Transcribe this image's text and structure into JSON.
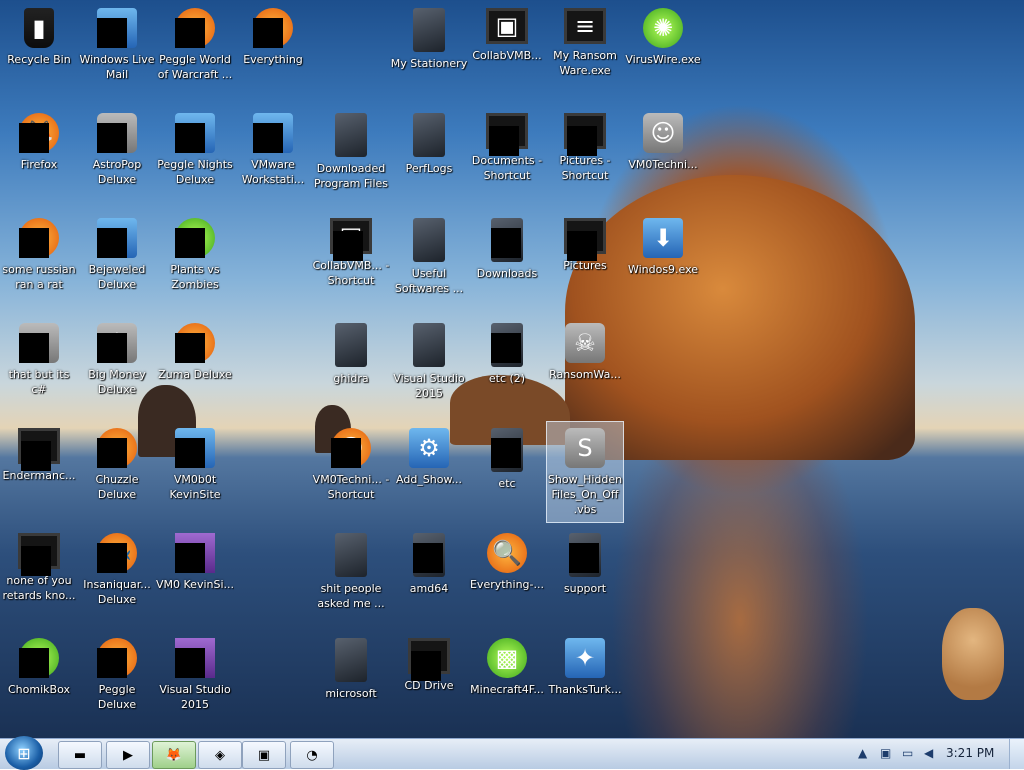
{
  "desktop": {
    "icons": [
      {
        "label": "Recycle Bin",
        "glyph": "▮"
      },
      {
        "label": "Windows Live Mail",
        "glyph": "✉"
      },
      {
        "label": "Peggle World of Warcraft ...",
        "glyph": "●"
      },
      {
        "label": "Everything",
        "glyph": "○"
      },
      {
        "label": "My Stationery",
        "glyph": ""
      },
      {
        "label": "CollabVMB...",
        "glyph": "▣"
      },
      {
        "label": "My Ransom Ware.exe",
        "glyph": "≡"
      },
      {
        "label": "VirusWire.exe",
        "glyph": "✺"
      },
      {
        "label": "Firefox",
        "glyph": "🦊"
      },
      {
        "label": "AstroPop Deluxe",
        "glyph": "★"
      },
      {
        "label": "Peggle Nights Deluxe",
        "glyph": "☾"
      },
      {
        "label": "VMware Workstati...",
        "glyph": "▤"
      },
      {
        "label": "Downloaded Program Files",
        "glyph": ""
      },
      {
        "label": "PerfLogs",
        "glyph": ""
      },
      {
        "label": "Documents - Shortcut",
        "glyph": ""
      },
      {
        "label": "Pictures - Shortcut",
        "glyph": ""
      },
      {
        "label": "VM0Techni...",
        "glyph": "☺"
      },
      {
        "label": "some russian ran a rat",
        "glyph": "e"
      },
      {
        "label": "Bejeweled Deluxe",
        "glyph": "◆"
      },
      {
        "label": "Plants vs Zombies",
        "glyph": "✿"
      },
      {
        "label": "CollabVMB... - Shortcut",
        "glyph": "▣"
      },
      {
        "label": "Useful Softwares ...",
        "glyph": ""
      },
      {
        "label": "Downloads",
        "glyph": ""
      },
      {
        "label": "Pictures",
        "glyph": ""
      },
      {
        "label": "Windos9.exe",
        "glyph": "⬇"
      },
      {
        "label": "that but its c#",
        "glyph": "▦"
      },
      {
        "label": "Big Money Deluxe",
        "glyph": "$"
      },
      {
        "label": "Zuma Deluxe",
        "glyph": "◉"
      },
      {
        "label": "ghidra",
        "glyph": ""
      },
      {
        "label": "Visual Studio 2015",
        "glyph": ""
      },
      {
        "label": "etc (2)",
        "glyph": ""
      },
      {
        "label": "RansomWa...",
        "glyph": "☠"
      },
      {
        "label": "Endermanc...",
        "glyph": "≡"
      },
      {
        "label": "Chuzzle Deluxe",
        "glyph": "●"
      },
      {
        "label": "VM0b0t KevinSite",
        "glyph": "▤"
      },
      {
        "label": "VM0Techni... - Shortcut",
        "glyph": "☺"
      },
      {
        "label": "Add_Show...",
        "glyph": "⚙"
      },
      {
        "label": "etc",
        "glyph": ""
      },
      {
        "label": "Show_Hidden Files_On_Off .vbs",
        "glyph": "S"
      },
      {
        "label": "none of you retards kno...",
        "glyph": ""
      },
      {
        "label": "Insaniquar... Deluxe",
        "glyph": "🐟"
      },
      {
        "label": "VM0 KevinSi...",
        "glyph": "▤"
      },
      {
        "label": "shit people asked me ...",
        "glyph": ""
      },
      {
        "label": "amd64",
        "glyph": ""
      },
      {
        "label": "Everything-...",
        "glyph": "🔍"
      },
      {
        "label": "support",
        "glyph": ""
      },
      {
        "label": "ChomikBox",
        "glyph": "▩"
      },
      {
        "label": "Peggle Deluxe",
        "glyph": "●"
      },
      {
        "label": "Visual Studio 2015",
        "glyph": "∞"
      },
      {
        "label": "microsoft",
        "glyph": ""
      },
      {
        "label": "CD Drive",
        "glyph": ""
      },
      {
        "label": "Minecraft4F...",
        "glyph": "▩"
      },
      {
        "label": "ThanksTurk...",
        "glyph": "✦"
      }
    ]
  },
  "taskbar": {
    "start_glyph": "⊞",
    "buttons": [
      {
        "name": "cmd",
        "glyph": "▬"
      },
      {
        "name": "media-player",
        "glyph": "▶"
      },
      {
        "name": "firefox",
        "glyph": "🦊"
      },
      {
        "name": "app-3",
        "glyph": "◈"
      },
      {
        "name": "app-4",
        "glyph": "▣"
      },
      {
        "name": "app-5",
        "glyph": "◔"
      }
    ],
    "tray": {
      "chevron": "▲",
      "clock": "3:21 PM"
    }
  }
}
